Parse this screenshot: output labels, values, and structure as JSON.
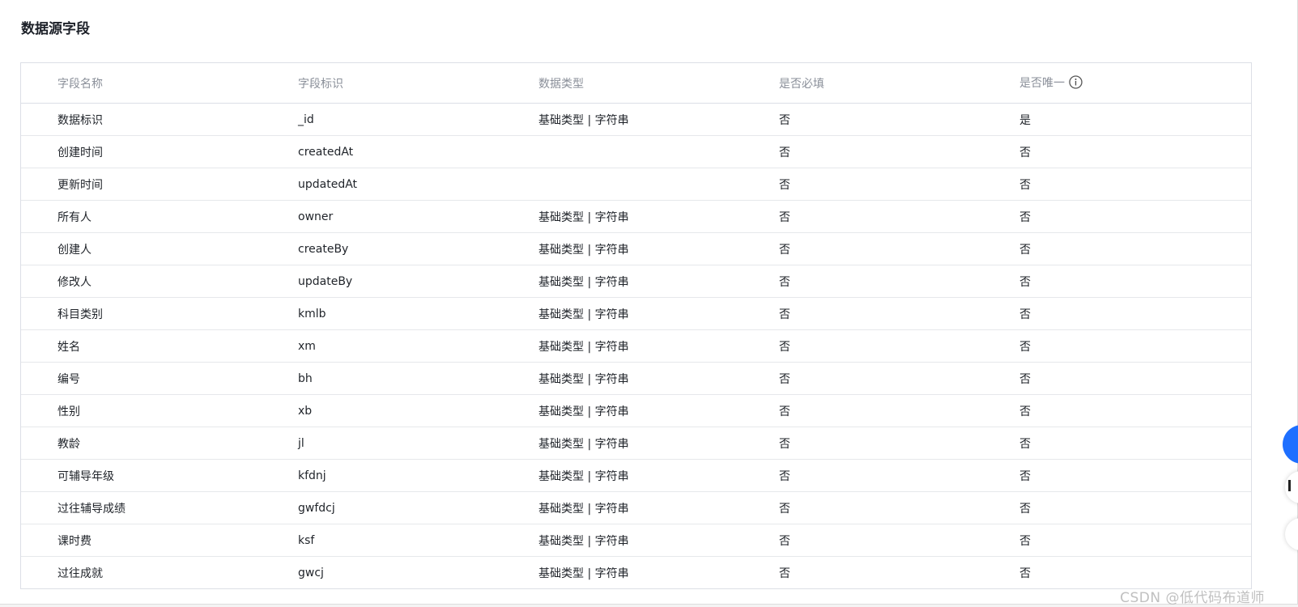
{
  "section": {
    "title": "数据源字段"
  },
  "table": {
    "headers": [
      "字段名称",
      "字段标识",
      "数据类型",
      "是否必填",
      "是否唯一"
    ],
    "rows": [
      [
        "数据标识",
        "_id",
        "基础类型 | 字符串",
        "否",
        "是"
      ],
      [
        "创建时间",
        "createdAt",
        "",
        "否",
        "否"
      ],
      [
        "更新时间",
        "updatedAt",
        "",
        "否",
        "否"
      ],
      [
        "所有人",
        "owner",
        "基础类型 | 字符串",
        "否",
        "否"
      ],
      [
        "创建人",
        "createBy",
        "基础类型 | 字符串",
        "否",
        "否"
      ],
      [
        "修改人",
        "updateBy",
        "基础类型 | 字符串",
        "否",
        "否"
      ],
      [
        "科目类别",
        "kmlb",
        "基础类型 | 字符串",
        "否",
        "否"
      ],
      [
        "姓名",
        "xm",
        "基础类型 | 字符串",
        "否",
        "否"
      ],
      [
        "编号",
        "bh",
        "基础类型 | 字符串",
        "否",
        "否"
      ],
      [
        "性别",
        "xb",
        "基础类型 | 字符串",
        "否",
        "否"
      ],
      [
        "教龄",
        "jl",
        "基础类型 | 字符串",
        "否",
        "否"
      ],
      [
        "可辅导年级",
        "kfdnj",
        "基础类型 | 字符串",
        "否",
        "否"
      ],
      [
        "过往辅导成绩",
        "gwfdcj",
        "基础类型 | 字符串",
        "否",
        "否"
      ],
      [
        "课时费",
        "ksf",
        "基础类型 | 字符串",
        "否",
        "否"
      ],
      [
        "过往成就",
        "gwcj",
        "基础类型 | 字符串",
        "否",
        "否"
      ]
    ]
  },
  "icons": {
    "unique_info": "info-icon"
  },
  "watermark": {
    "text": "CSDN @低代码布道师"
  },
  "colors": {
    "accent": "#1e6fff",
    "header_text": "#8a8f99",
    "border": "#dcdfe6"
  }
}
